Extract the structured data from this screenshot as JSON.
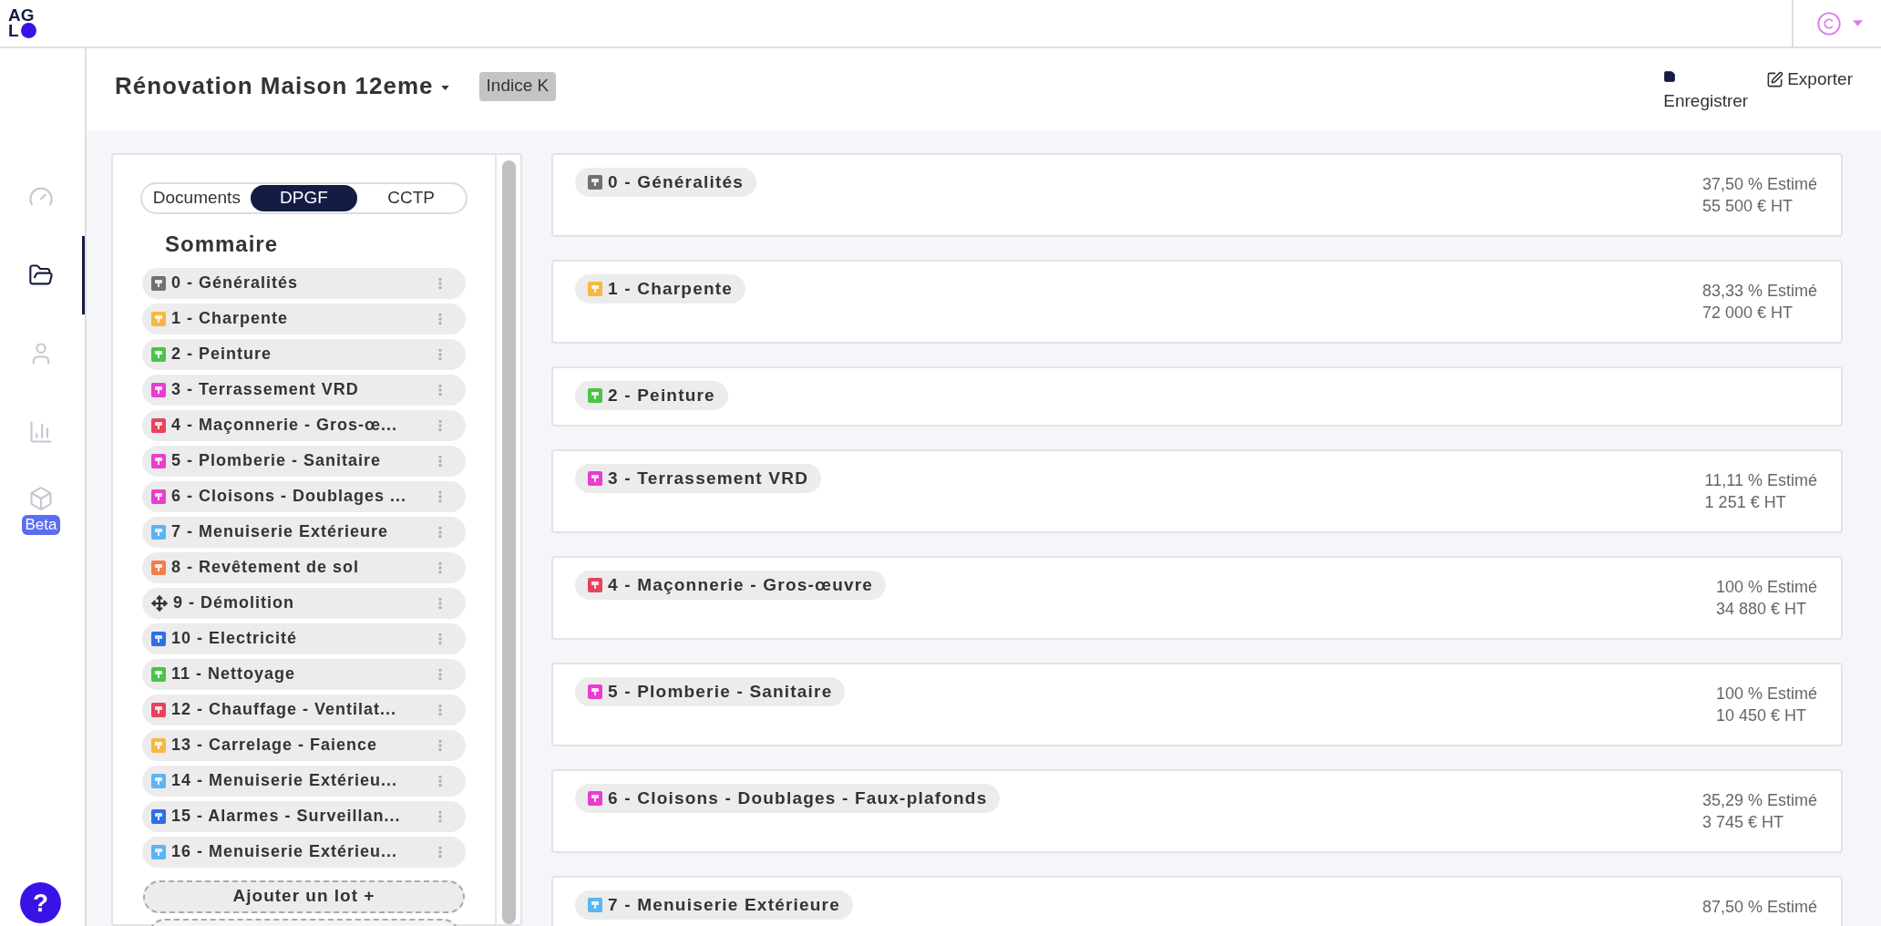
{
  "app_bar": {
    "logo_top": "AG",
    "logo_bottom": "L"
  },
  "nav": [
    {
      "kind": "gauge",
      "selected": false
    },
    {
      "kind": "folder",
      "selected": true
    },
    {
      "kind": "user",
      "selected": false
    },
    {
      "kind": "chart",
      "selected": false
    },
    {
      "kind": "cube",
      "selected": false,
      "badge": "Beta"
    }
  ],
  "help_button": "?",
  "project": {
    "title": "Rénovation Maison 12eme",
    "index_badge": "Indice K"
  },
  "actions": [
    {
      "kind": "save",
      "label": "Enregistrer"
    },
    {
      "kind": "export",
      "label": "Exporter"
    }
  ],
  "view_tabs": [
    {
      "label": "Documents",
      "selected": false
    },
    {
      "label": "DPGF",
      "selected": true
    },
    {
      "label": "CCTP",
      "selected": false
    }
  ],
  "summary": {
    "title": "Sommaire",
    "items": [
      {
        "label": "0 - Généralités",
        "color": "#707070",
        "kind": "square"
      },
      {
        "label": "1 - Charpente",
        "color": "#f5b942",
        "kind": "square"
      },
      {
        "label": "2 - Peinture",
        "color": "#4cc24a",
        "kind": "square"
      },
      {
        "label": "3 - Terrassement VRD",
        "color": "#e93dcf",
        "kind": "square"
      },
      {
        "label": "4 - Maçonnerie - Gros-œ...",
        "color": "#e8435a",
        "kind": "square"
      },
      {
        "label": "5 - Plomberie - Sanitaire",
        "color": "#e93dcf",
        "kind": "square"
      },
      {
        "label": "6 - Cloisons - Doublages ...",
        "color": "#e93dcf",
        "kind": "square"
      },
      {
        "label": "7 - Menuiserie Extérieure",
        "color": "#5ab4f5",
        "kind": "square"
      },
      {
        "label": "8 - Revêtement de sol",
        "color": "#f0804a",
        "kind": "square"
      },
      {
        "label": "9 - Démolition",
        "color": "#333333",
        "kind": "arrows"
      },
      {
        "label": "10 - Electricité",
        "color": "#2f6fe8",
        "kind": "square"
      },
      {
        "label": "11 - Nettoyage",
        "color": "#4cc24a",
        "kind": "square"
      },
      {
        "label": "12 - Chauffage - Ventilat...",
        "color": "#e8435a",
        "kind": "square"
      },
      {
        "label": "13 - Carrelage - Faience",
        "color": "#f5b942",
        "kind": "square"
      },
      {
        "label": "14 - Menuiserie Extérieu...",
        "color": "#5ab4f5",
        "kind": "square"
      },
      {
        "label": "15 - Alarmes - Surveillan...",
        "color": "#2f6fe8",
        "kind": "square"
      },
      {
        "label": "16 - Menuiserie Extérieu...",
        "color": "#5ab4f5",
        "kind": "square"
      }
    ],
    "add_button": "Ajouter un lot +"
  },
  "lots": [
    {
      "title": "0 - Généralités",
      "color": "#707070",
      "estimate": "37,50 % Estimé",
      "amount": "55 500 € HT"
    },
    {
      "title": "1 - Charpente",
      "color": "#f5b942",
      "estimate": "83,33 % Estimé",
      "amount": "72 000 € HT"
    },
    {
      "title": "2 - Peinture",
      "color": "#4cc24a"
    },
    {
      "title": "3 - Terrassement VRD",
      "color": "#e93dcf",
      "estimate": "11,11 % Estimé",
      "amount": "1 251 € HT"
    },
    {
      "title": "4 - Maçonnerie - Gros-œuvre",
      "color": "#e8435a",
      "estimate": "100 % Estimé",
      "amount": "34 880 € HT"
    },
    {
      "title": "5 - Plomberie - Sanitaire",
      "color": "#e93dcf",
      "estimate": "100 % Estimé",
      "amount": "10 450 € HT"
    },
    {
      "title": "6 - Cloisons - Doublages - Faux-plafonds",
      "color": "#e93dcf",
      "estimate": "35,29 % Estimé",
      "amount": "3 745 € HT"
    },
    {
      "title": "7 - Menuiserie Extérieure",
      "color": "#5ab4f5",
      "estimate": "87,50 % Estimé"
    }
  ]
}
